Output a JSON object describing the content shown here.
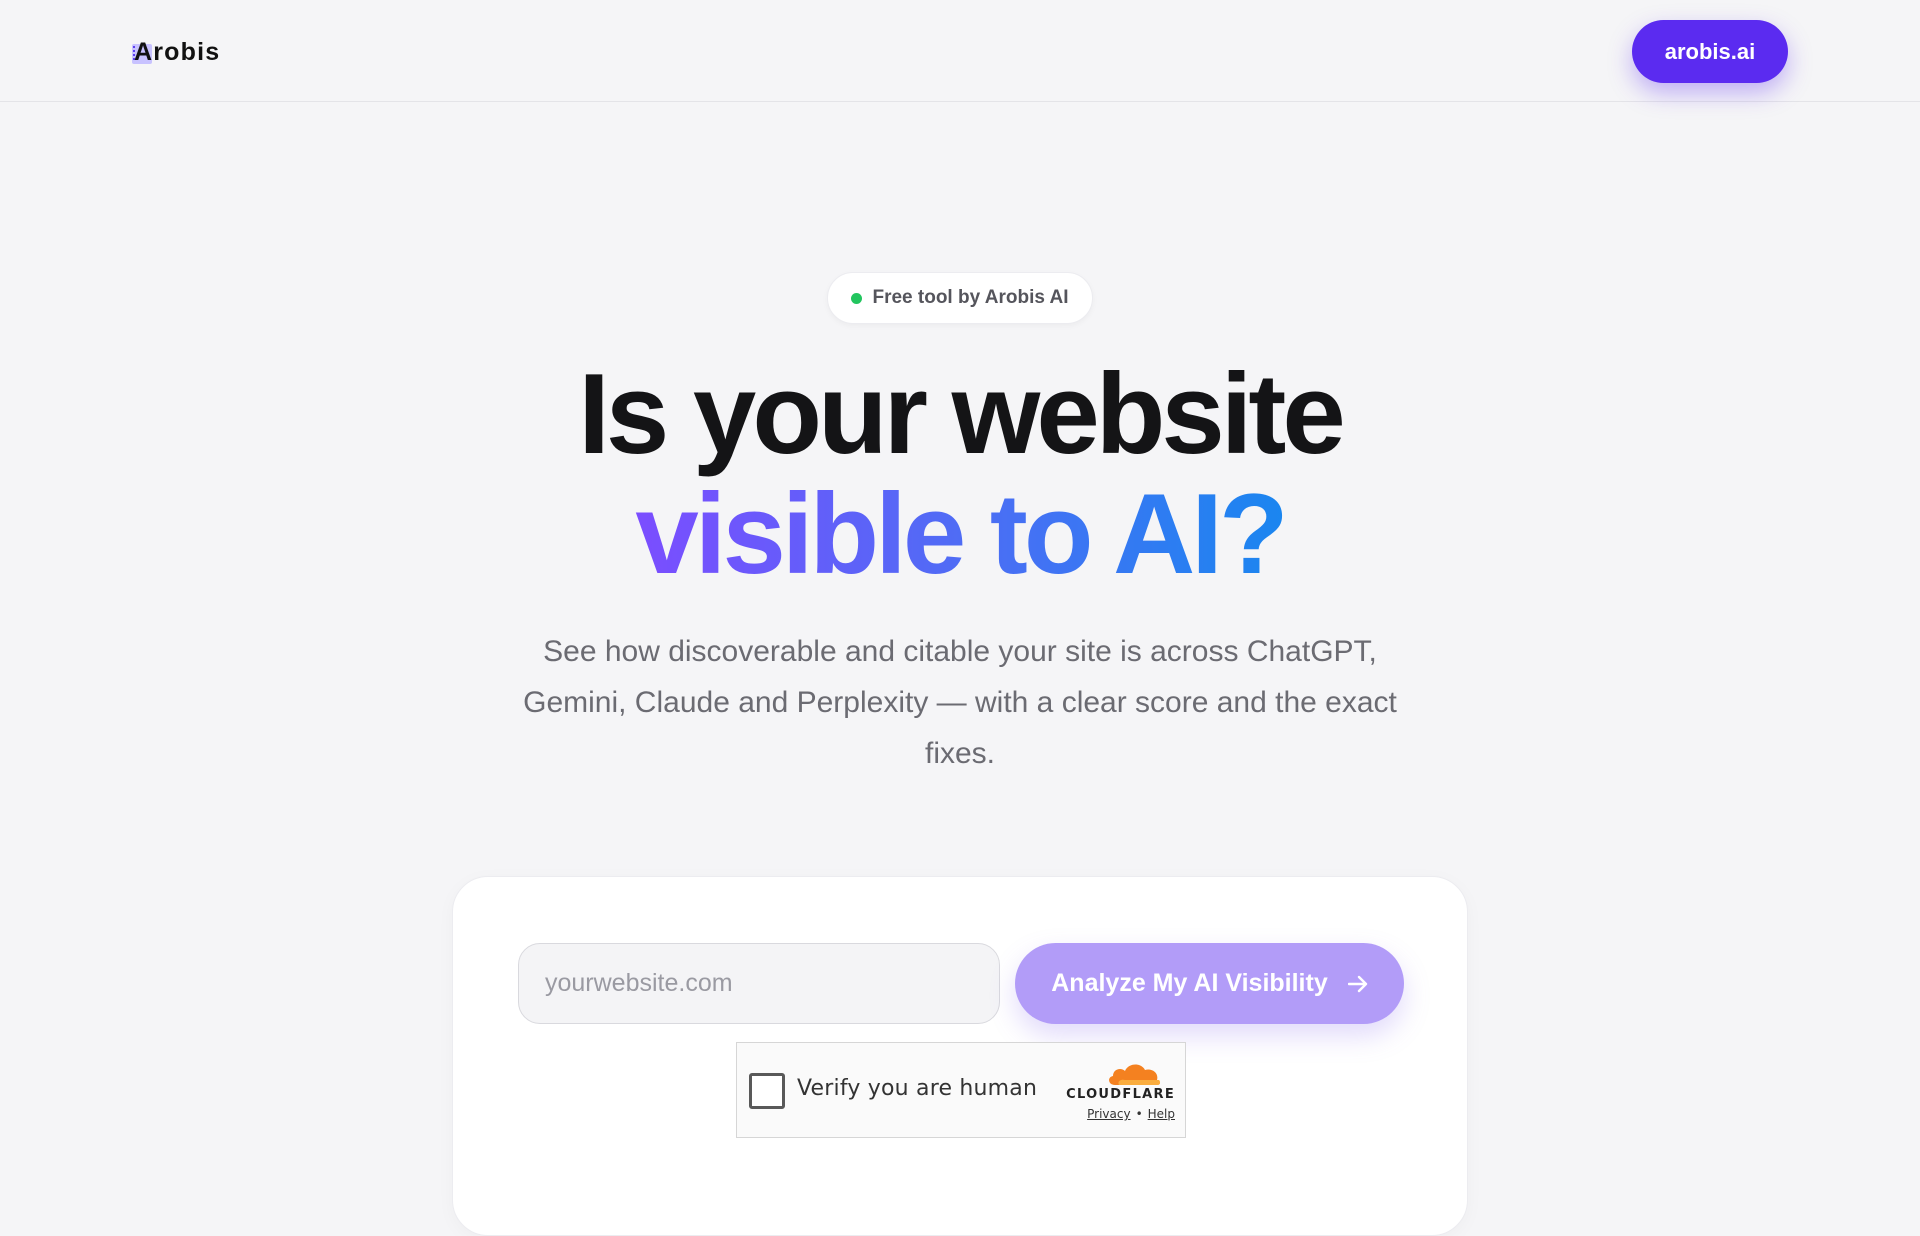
{
  "header": {
    "logo_text": "Arobis",
    "cta_label": "arobis.ai"
  },
  "hero": {
    "badge_text": "Free tool by Arobis AI",
    "headline_line1": "Is your website",
    "headline_line2": "visible to AI?",
    "subtitle": "See how discoverable and citable your site is across ChatGPT, Gemini, Claude and Perplexity — with a clear score and the exact fixes."
  },
  "form": {
    "url_placeholder": "yourwebsite.com",
    "url_value": "",
    "submit_label": "Analyze My AI Visibility",
    "submit_icon": "arrow-right-icon"
  },
  "captcha": {
    "label": "Verify you are human",
    "brand": "CLOUDFLARE",
    "privacy_link": "Privacy",
    "separator": "•",
    "help_link": "Help",
    "checked": false
  },
  "colors": {
    "brand_purple": "#5b2bf0",
    "button_light_purple": "#b29cf8",
    "gradient_start": "#7b4dff",
    "gradient_end": "#1a86f0",
    "status_green": "#22c55e",
    "page_background": "#f5f5f7",
    "cloudflare_orange": "#f48120"
  }
}
